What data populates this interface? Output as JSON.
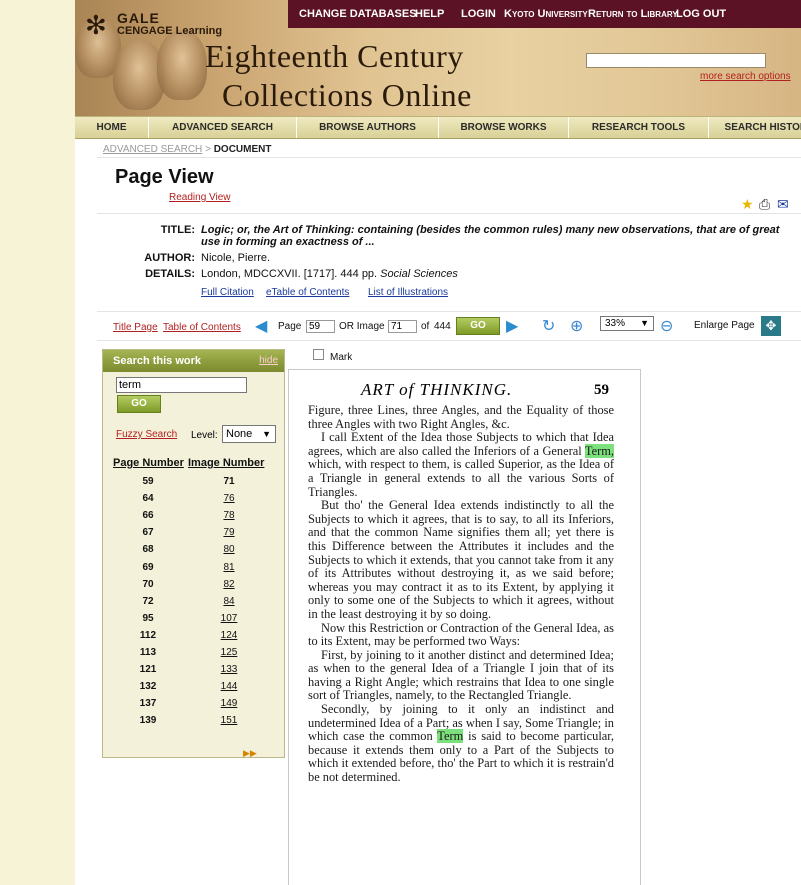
{
  "header": {
    "brand_gale": "GALE",
    "brand_cengage": "CENGAGE Learning",
    "title_line1": "Eighteenth Century",
    "title_line2": "Collections Online",
    "top_links": [
      "CHANGE DATABASES",
      "HELP",
      "LOGIN",
      "Kyoto University",
      "Return to Library",
      "LOG OUT"
    ],
    "search_value": "",
    "more_search": "more search options"
  },
  "nav": [
    "HOME",
    "ADVANCED SEARCH",
    "BROWSE AUTHORS",
    "BROWSE WORKS",
    "RESEARCH TOOLS",
    "SEARCH HISTORY"
  ],
  "breadcrumb": {
    "link": "ADVANCED SEARCH",
    "sep": ">",
    "current": "DOCUMENT"
  },
  "page": {
    "title": "Page View",
    "reading_view": "Reading View"
  },
  "meta": {
    "title_label": "TITLE:",
    "title": "Logic; or, the Art of Thinking: containing (besides the common rules) many new observations, that are of great use in forming an exactness of ...",
    "author_label": "AUTHOR:",
    "author": "Nicole, Pierre.",
    "details_label": "DETAILS:",
    "details": "London, MDCCXVII. [1717]. 444 pp.",
    "details_subject": "Social Sciences",
    "links": [
      "Full Citation",
      "eTable of Contents",
      "List of Illustrations"
    ]
  },
  "toolbar": {
    "title_page": "Title Page",
    "toc": "Table of Contents",
    "page_label": "Page",
    "page_value": "59",
    "or_image": "OR Image",
    "image_value": "71",
    "of": "of",
    "total": "444",
    "go": "GO",
    "zoom": "33%",
    "enlarge": "Enlarge Page"
  },
  "search_panel": {
    "title": "Search this work",
    "hide": "hide",
    "term": "term",
    "go": "GO",
    "fuzzy": "Fuzzy Search",
    "level_label": "Level:",
    "level_value": "None",
    "col_page": "Page Number",
    "col_image": "Image Number",
    "results": [
      {
        "page": "59",
        "image": "71"
      },
      {
        "page": "64",
        "image": "76"
      },
      {
        "page": "66",
        "image": "78"
      },
      {
        "page": "67",
        "image": "79"
      },
      {
        "page": "68",
        "image": "80"
      },
      {
        "page": "69",
        "image": "81"
      },
      {
        "page": "70",
        "image": "82"
      },
      {
        "page": "72",
        "image": "84"
      },
      {
        "page": "95",
        "image": "107"
      },
      {
        "page": "112",
        "image": "124"
      },
      {
        "page": "113",
        "image": "125"
      },
      {
        "page": "121",
        "image": "133"
      },
      {
        "page": "132",
        "image": "144"
      },
      {
        "page": "137",
        "image": "149"
      },
      {
        "page": "139",
        "image": "151"
      }
    ]
  },
  "mark_label": "Mark",
  "document": {
    "running_head": "ART of THINKING.",
    "page_number": "59",
    "p1": "Figure, three Lines, three Angles, and the Equality of those three Angles with two Right Angles, &c.",
    "p2_a": "I call Extent of the Idea those Subjects to which that Idea agrees, which are also called the Inferiors of a General",
    "p2_hl": "Term,",
    "p2_b": "which, with respect to them, is called Superior, as the Idea of a Triangle in general extends to all the various Sorts of Triangles.",
    "p3": "But tho' the General Idea extends indistinctly to all the Subjects to which it agrees, that is to say, to all its Inferiors, and that the common Name signifies them all; yet there is this Difference between the Attributes it includes and the Subjects to which it extends, that you cannot take from it any of its Attributes without destroying it, as we said before; whereas you may contract it as to its Extent, by applying it only to some one of the Subjects to which it agrees, without in the least destroying it by so doing.",
    "p4": "Now this Restriction or Contraction of the General Idea, as to its Extent, may be performed two Ways:",
    "p5": "First, by joining to it another distinct and determined Idea; as when to the general Idea of a Triangle I join that of its having a Right Angle; which restrains that Idea to one single sort of Triangles, namely, to the Rectangled Triangle.",
    "p6_a": "Secondly, by joining to it only an indistinct and undetermined Idea of a Part; as when I say, Some Triangle; in which case the common",
    "p6_hl": "Term",
    "p6_b": "is said to become particular, because it extends them only to a Part of the Subjects to which it extended before, tho' the Part to which it is restrain'd be not determined."
  }
}
